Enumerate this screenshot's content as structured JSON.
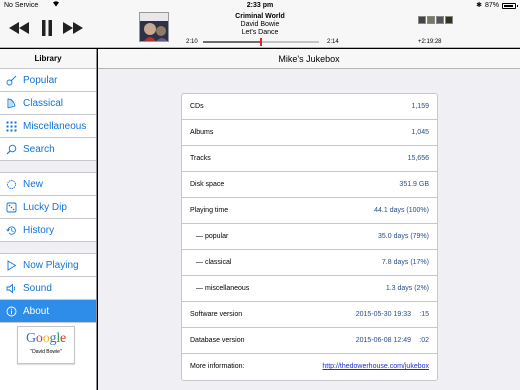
{
  "status_bar": {
    "carrier": "No Service",
    "time": "2:33 pm",
    "battery": "87%",
    "battery_level": 0.87
  },
  "player": {
    "track_title": "Criminal World",
    "artist": "David Bowie",
    "album": "Let's Dance",
    "elapsed": "2:10",
    "duration": "2:14",
    "progress_fraction": 0.5,
    "queue_remaining": "+2:19:28",
    "icons": {
      "previous": "previous-track-icon",
      "pause": "pause-icon",
      "next": "next-track-icon"
    }
  },
  "sidebar": {
    "header": "Library",
    "sections": [
      [
        {
          "key": "popular",
          "label": "Popular",
          "icon": "guitar-icon"
        },
        {
          "key": "classical",
          "label": "Classical",
          "icon": "harp-icon"
        },
        {
          "key": "miscellaneous",
          "label": "Miscellaneous",
          "icon": "grid-icon"
        },
        {
          "key": "search",
          "label": "Search",
          "icon": "magnifier-icon"
        }
      ],
      [
        {
          "key": "new",
          "label": "New",
          "icon": "badge-icon"
        },
        {
          "key": "lucky-dip",
          "label": "Lucky Dip",
          "icon": "dice-icon"
        },
        {
          "key": "history",
          "label": "History",
          "icon": "history-icon"
        }
      ],
      [
        {
          "key": "now-playing",
          "label": "Now Playing",
          "icon": "play-icon"
        },
        {
          "key": "sound",
          "label": "Sound",
          "icon": "speaker-icon"
        },
        {
          "key": "about",
          "label": "About",
          "icon": "info-icon",
          "active": true
        }
      ]
    ],
    "google": {
      "logo": "Google",
      "query": "\"David Bowie\""
    }
  },
  "main": {
    "title": "Mike's Jukebox",
    "stats": {
      "cds": {
        "label": "CDs",
        "value": "1,159"
      },
      "albums": {
        "label": "Albums",
        "value": "1,045"
      },
      "tracks": {
        "label": "Tracks",
        "value": "15,656"
      },
      "disk_space": {
        "label": "Disk space",
        "value": "351.9 GB"
      },
      "playing_time": {
        "label": "Playing time",
        "value": "44.1 days (100%)"
      },
      "popular": {
        "label": "— popular",
        "value": "35.0 days (79%)"
      },
      "classical": {
        "label": "— classical",
        "value": "7.8 days (17%)"
      },
      "miscellaneous": {
        "label": "— miscellaneous",
        "value": "1.3 days (2%)"
      },
      "software_version": {
        "label": "Software version",
        "date": "2015-05-30 19:33",
        "suffix": ":15"
      },
      "database_version": {
        "label": "Database version",
        "date": "2015-06-08 12:49",
        "suffix": ":02"
      },
      "more_info": {
        "label": "More information:",
        "value": "http://thedowerhouse.com/jukebox"
      }
    }
  },
  "colors": {
    "accent": "#1173d9",
    "active_background": "#2d8de8",
    "value_text": "#2a4d8a",
    "link": "#1a2fd6",
    "progress_marker": "#e22222"
  }
}
